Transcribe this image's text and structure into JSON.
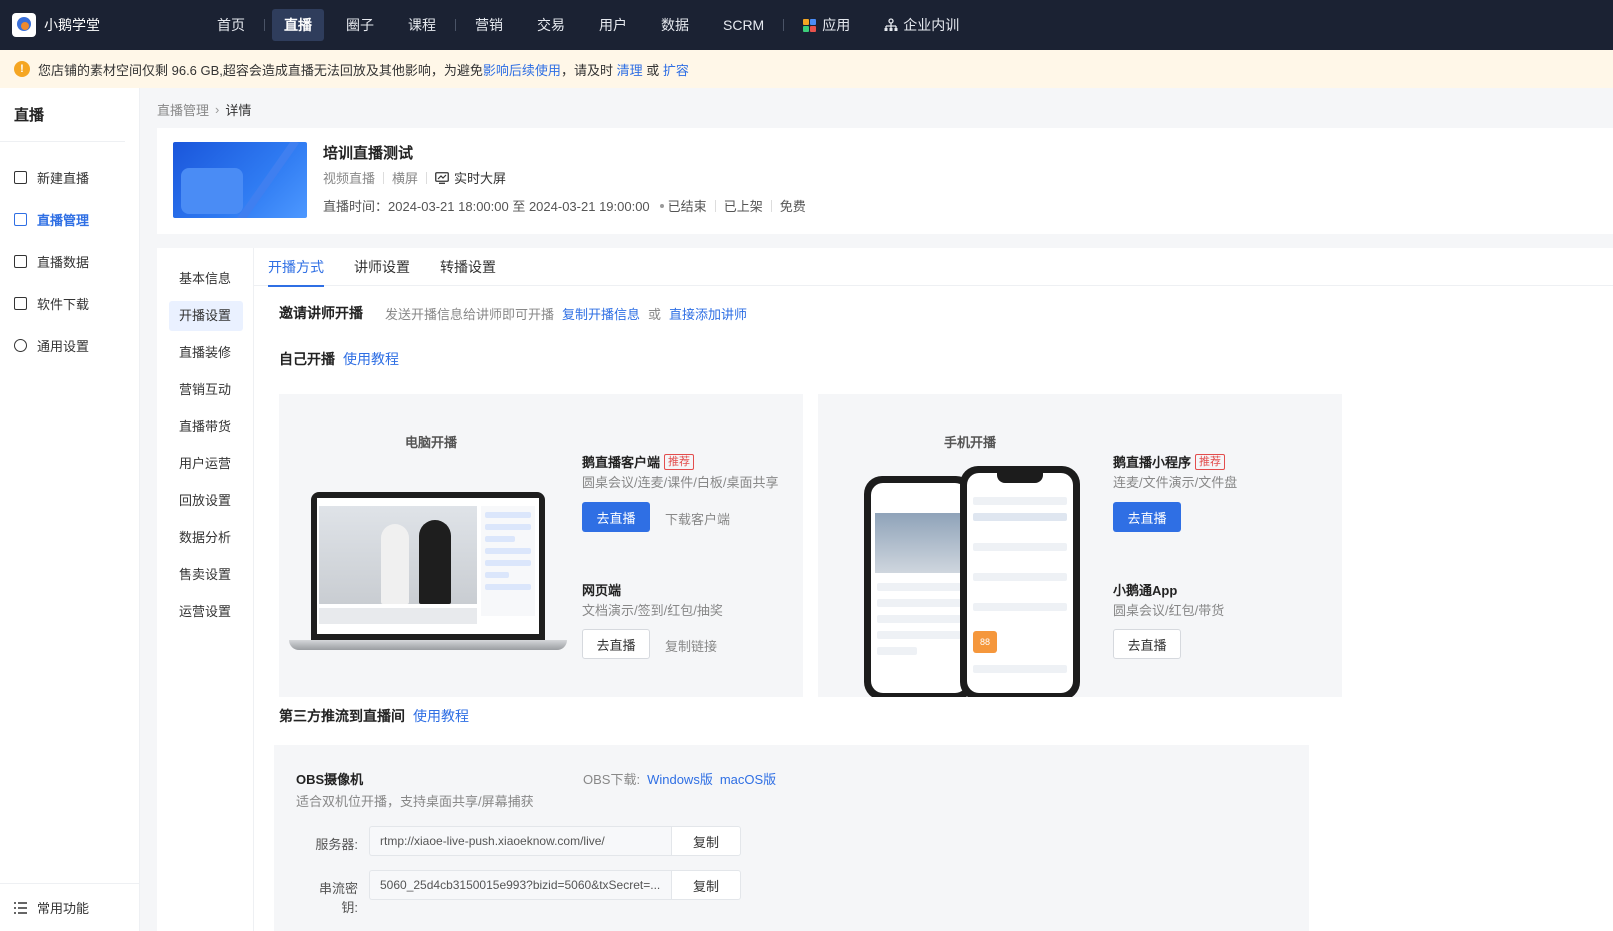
{
  "brand": {
    "name": "小鹅学堂"
  },
  "topnav": {
    "items": [
      "首页",
      "直播",
      "圈子",
      "课程",
      "营销",
      "交易",
      "用户",
      "数据",
      "SCRM",
      "应用",
      "企业内训"
    ],
    "active_index": 1
  },
  "warning": {
    "text": "您店铺的素材空间仅剩 96.6 GB,超容会造成直播无法回放及其他影响，为避免",
    "link": "影响后续使用",
    "text2": "，请及时",
    "clean": "清理",
    "or": "或",
    "expand": "扩容"
  },
  "sidebar": {
    "title": "直播",
    "items": [
      "新建直播",
      "直播管理",
      "直播数据",
      "软件下载",
      "通用设置"
    ],
    "active_index": 1,
    "bottom": "常用功能"
  },
  "breadcrumb": {
    "parent": "直播管理",
    "current": "详情"
  },
  "header": {
    "title": "培训直播测试",
    "type": "视频直播",
    "orientation": "横屏",
    "screen": "实时大屏",
    "time_label": "直播时间：",
    "time": "2024-03-21 18:00:00 至 2024-03-21 19:00:00",
    "status": "已结束",
    "listed": "已上架",
    "price": "免费"
  },
  "subnav": {
    "items": [
      "基本信息",
      "开播设置",
      "直播装修",
      "营销互动",
      "直播带货",
      "用户运营",
      "回放设置",
      "数据分析",
      "售卖设置",
      "运营设置"
    ],
    "active_index": 1
  },
  "tabs": {
    "items": [
      "开播方式",
      "讲师设置",
      "转播设置"
    ],
    "active_index": 0
  },
  "invite": {
    "title": "邀请讲师开播",
    "desc": "发送开播信息给讲师即可开播",
    "copy": "复制开播信息",
    "or": "或",
    "add": "直接添加讲师"
  },
  "self": {
    "title": "自己开播",
    "tutorial": "使用教程"
  },
  "pc": {
    "title": "电脑开播",
    "client_title": "鹅直播客户端",
    "badge": "推荐",
    "client_desc": "圆桌会议/连麦/课件/白板/桌面共享",
    "go": "去直播",
    "download": "下载客户端",
    "web_title": "网页端",
    "web_desc": "文档演示/签到/红包/抽奖",
    "web_go": "去直播",
    "copy_link": "复制链接"
  },
  "mobile": {
    "title": "手机开播",
    "mini_title": "鹅直播小程序",
    "badge": "推荐",
    "mini_desc": "连麦/文件演示/文件盘",
    "go": "去直播",
    "app_title": "小鹅通App",
    "app_desc": "圆桌会议/红包/带货",
    "app_go": "去直播"
  },
  "third": {
    "title": "第三方推流到直播间",
    "tutorial": "使用教程"
  },
  "obs": {
    "title": "OBS摄像机",
    "desc": "适合双机位开播，支持桌面共享/屏幕捕获",
    "dl_label": "OBS下载:",
    "windows": "Windows版",
    "mac": "macOS版",
    "server_label": "服务器:",
    "server": "rtmp://xiaoe-live-push.xiaoeknow.com/live/",
    "key_label": "串流密钥:",
    "key": "5060_25d4cb3150015e993?bizid=5060&txSecret=...",
    "copy": "复制"
  },
  "colors": {
    "nav_bg": "#1b2233",
    "primary": "#2f6fe4",
    "warn_bg": "#fff7e8",
    "badge": "#e34d4d"
  }
}
